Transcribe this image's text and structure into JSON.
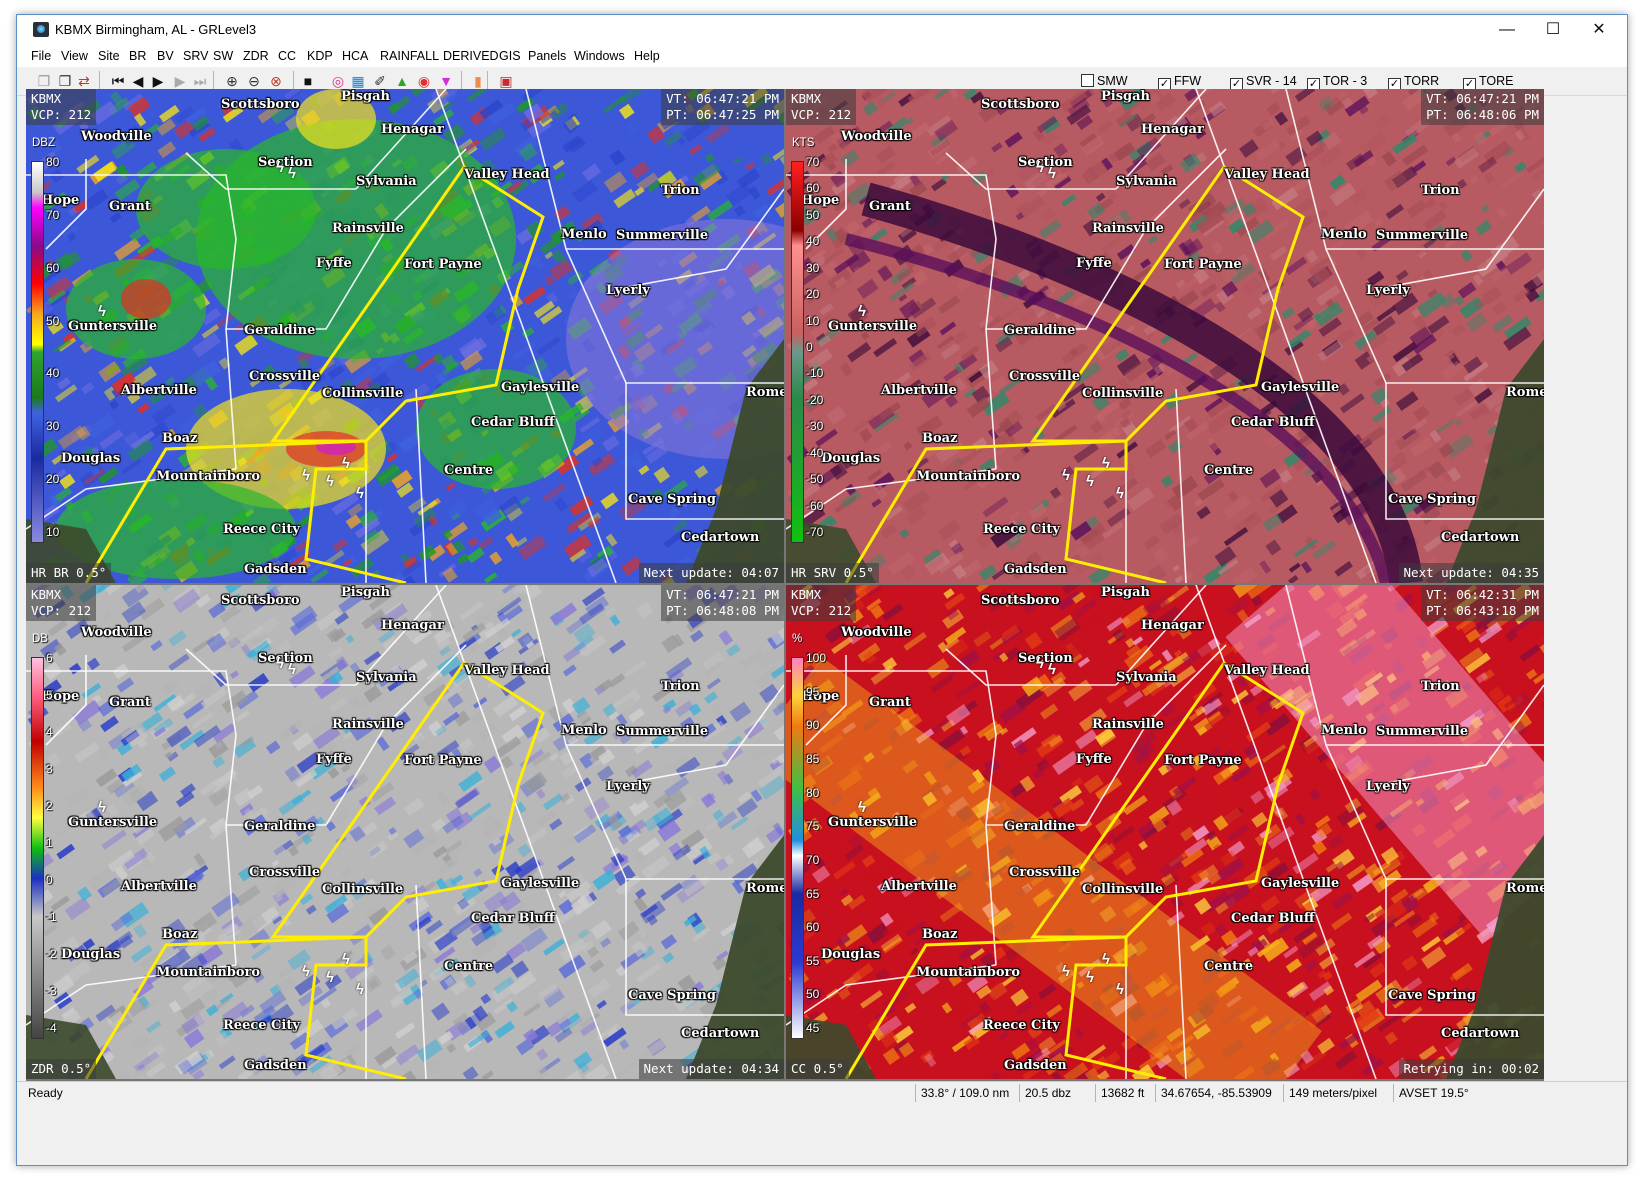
{
  "window": {
    "title": "KBMX Birmingham, AL - GRLevel3",
    "controls": {
      "minimize": "—",
      "maximize": "☐",
      "close": "✕"
    }
  },
  "menu": [
    "File",
    "View",
    "Site",
    "BR",
    "BV",
    "SRV",
    "SW",
    "ZDR",
    "CC",
    "KDP",
    "HCA",
    "RAINFALL",
    "DERIVED",
    "GIS",
    "Panels",
    "Windows",
    "Help"
  ],
  "toolbar": {
    "icons": [
      "copy-icon",
      "paste-icon",
      "swap-icon",
      "first-frame-icon",
      "prev-frame-icon",
      "play-icon",
      "next-frame-icon",
      "last-frame-icon",
      "zoom-in-icon",
      "zoom-out-icon",
      "zoom-reset-icon",
      "black-square-icon",
      "rings-icon",
      "grid-icon",
      "pin-icon",
      "triangle-icon",
      "circle-icon",
      "down-triangle-icon",
      "orange-rect-icon",
      "stop-icon"
    ],
    "warnings": [
      {
        "label": "SMW",
        "checked": false
      },
      {
        "label": "FFW",
        "checked": true
      },
      {
        "label": "SVR - 14",
        "checked": true
      },
      {
        "label": "TOR - 3",
        "checked": true
      },
      {
        "label": "TORR",
        "checked": true
      },
      {
        "label": "TORE",
        "checked": true
      }
    ]
  },
  "cities": [
    "Scottsboro",
    "Pisgah",
    "Henagar",
    "Woodville",
    "Section",
    "Sylvania",
    "Valley Head",
    "Trion",
    "Grant",
    "Rainsville",
    "Menlo",
    "Summerville",
    "Fyffe",
    "Fort Payne",
    "Lyerly",
    "Guntersville",
    "Geraldine",
    "Crossville",
    "Collinsville",
    "Gaylesville",
    "Albertville",
    "Rome",
    "Boaz",
    "Cedar Bluff",
    "Douglas",
    "Centre",
    "Mountainboro",
    "Cave Spring",
    "Reece City",
    "Cedartown",
    "Gadsden",
    "Hope"
  ],
  "panels": [
    {
      "site": "KBMX",
      "vcp": "VCP: 212",
      "vt": "VT: 06:47:21 PM",
      "pt": "PT: 06:47:25 PM",
      "product": "HR BR 0.5°",
      "status": "Next update: 04:07",
      "unit": "DBZ",
      "scale_ticks": [
        "80",
        "70",
        "60",
        "50",
        "40",
        "30",
        "20",
        "10"
      ],
      "colors": {
        "bg": "#3c58d8",
        "accent": "#2fb82f"
      }
    },
    {
      "site": "KBMX",
      "vcp": "VCP: 212",
      "vt": "VT: 06:47:21 PM",
      "pt": "PT: 06:48:06 PM",
      "product": "HR SRV 0.5°",
      "status": "Next update: 04:35",
      "unit": "KTS",
      "scale_ticks": [
        "70",
        "60",
        "50",
        "40",
        "30",
        "20",
        "10",
        "0",
        "-10",
        "-20",
        "-30",
        "-40",
        "-50",
        "-60",
        "-70"
      ],
      "colors": {
        "bg": "#b85a62",
        "accent": "#4a0a4a"
      }
    },
    {
      "site": "KBMX",
      "vcp": "VCP: 212",
      "vt": "VT: 06:47:21 PM",
      "pt": "PT: 06:48:08 PM",
      "product": "ZDR 0.5°",
      "status": "Next update: 04:34",
      "unit": "DB",
      "scale_ticks": [
        "6",
        "5",
        "4",
        "3",
        "2",
        "1",
        "0",
        "-1",
        "-2",
        "-3",
        "-4"
      ],
      "colors": {
        "bg": "#b8b8b8",
        "accent": "#2438c8"
      }
    },
    {
      "site": "KBMX",
      "vcp": "VCP: 212",
      "vt": "VT: 06:42:31 PM",
      "pt": "PT: 06:43:18 PM",
      "product": "CC 0.5°",
      "status": "Retrying in: 00:02",
      "unit": "%",
      "scale_ticks": [
        "100",
        "95",
        "90",
        "85",
        "80",
        "75",
        "70",
        "65",
        "60",
        "55",
        "50",
        "45"
      ],
      "colors": {
        "bg": "#c8101e",
        "accent": "#ff8a1a"
      }
    }
  ],
  "statusbar": {
    "ready": "Ready",
    "azran": "33.8° / 109.0 nm",
    "value": "20.5 dbz",
    "height": "13682 ft",
    "latlon": "34.67654, -85.53909",
    "res": "149 meters/pixel",
    "avset": "AVSET 19.5°"
  }
}
